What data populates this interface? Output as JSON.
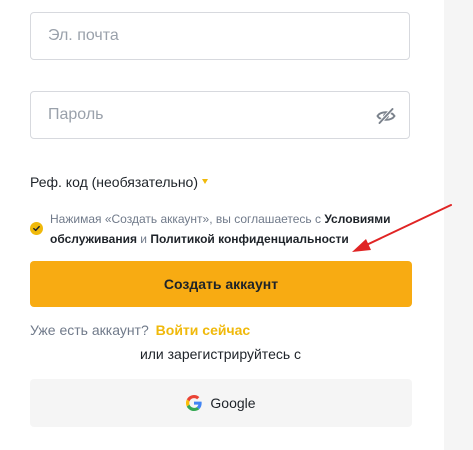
{
  "form": {
    "email_placeholder": "Эл. почта",
    "password_placeholder": "Пароль",
    "referral_label": "Реф. код (необязательно)",
    "terms": {
      "prefix": "Нажимая «Создать аккаунт», вы соглашаетесь с ",
      "terms_link": "Условиями обслуживания",
      "conjunction": " и ",
      "privacy_link": "Политикой конфиденциальности",
      "checked": true
    },
    "submit_label": "Создать аккаунт",
    "login_prompt": "Уже есть аккаунт?",
    "login_link": "Войти сейчас",
    "alt_signup_label": "или зарегистрируйтесь с",
    "google_label": "Google"
  },
  "colors": {
    "accent": "#f8ab12",
    "link_accent": "#f0b90b",
    "annotation_arrow": "#e02424"
  },
  "icons": {
    "password_toggle": "eye-slash-icon",
    "checkbox": "check-icon",
    "google": "google-logo-icon",
    "referral": "caret-down-icon"
  }
}
